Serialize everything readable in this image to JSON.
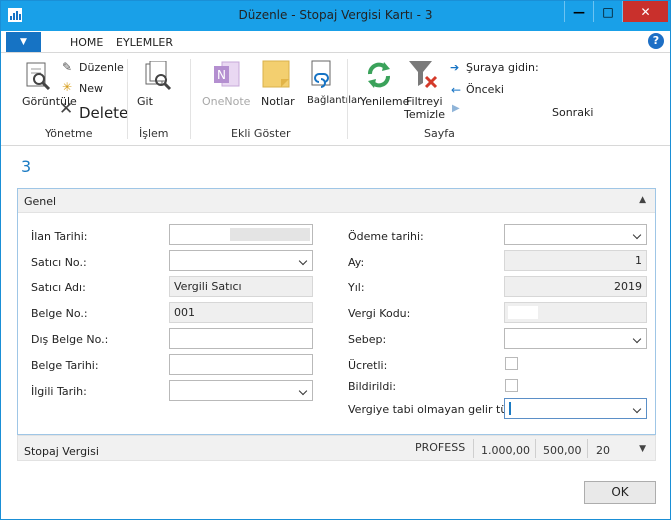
{
  "window": {
    "title": "Düzenle - Stopaj Vergisi Kartı - 3",
    "minimize": "—",
    "maximize": "□",
    "close": "✕"
  },
  "ribbon_tabs": {
    "app_menu": "▼",
    "home": "HOME",
    "actions": "EYLEMLER",
    "help": "?"
  },
  "ribbon": {
    "view": "Görüntüle",
    "edit": "Düzenle",
    "new": "New",
    "delete": "Delete",
    "group_manage": "Yönetme",
    "go": "Git",
    "group_process": "İşlem",
    "onenote": "OneNote",
    "notes": "Notlar",
    "links": "Bağlantılar",
    "group_show_attached": "Ekli Göster",
    "refresh": "Yenileme",
    "clear_filter_line1": "Filtreyi",
    "clear_filter_line2": "Temizle",
    "goto": "Şuraya gidin:",
    "previous": "Önceki",
    "next": "Sonraki",
    "group_page": "Sayfa"
  },
  "page_number": "3",
  "general": {
    "title": "Genel",
    "left_fields": [
      {
        "label": "İlan Tarihi:",
        "value": ""
      },
      {
        "label": "Satıcı No.:",
        "value": ""
      },
      {
        "label": "Satıcı Adı:",
        "value": "Vergili Satıcı"
      },
      {
        "label": "Belge No.:",
        "value": "001"
      },
      {
        "label": "Dış Belge No.:",
        "value": ""
      },
      {
        "label": "Belge Tarihi:",
        "value": ""
      },
      {
        "label": "İlgili Tarih:",
        "value": ""
      }
    ],
    "right_fields": [
      {
        "label": "Ödeme tarihi:",
        "value": ""
      },
      {
        "label": "Ay:",
        "value": "1"
      },
      {
        "label": "Yıl:",
        "value": "2019"
      },
      {
        "label": "Vergi Kodu:",
        "value": ""
      },
      {
        "label": "Sebep:",
        "value": ""
      },
      {
        "label": "Ücretli:",
        "value": ""
      },
      {
        "label": "Bildirildi:",
        "value": ""
      },
      {
        "label": "Vergiye tabi olmayan gelir türü:",
        "value": ""
      }
    ]
  },
  "stopaj": {
    "title": "Stopaj Vergisi",
    "code": "PROFESS",
    "amount1": "1.000,00",
    "amount2": "500,00",
    "percent": "20"
  },
  "ok": "OK",
  "colors": {
    "titlebar": "#19a0e8",
    "accent": "#1c7bc3",
    "close": "#c9302c"
  }
}
